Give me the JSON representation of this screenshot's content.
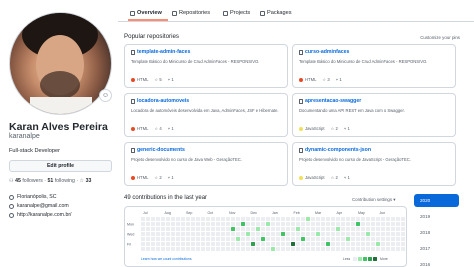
{
  "tabs": [
    {
      "label": "Overview",
      "active": true
    },
    {
      "label": "Repositories",
      "active": false
    },
    {
      "label": "Projects",
      "active": false
    },
    {
      "label": "Packages",
      "active": false
    }
  ],
  "profile": {
    "name": "Karan Alves Pereira",
    "login": "karanalpe",
    "bio": "Full-stack Developer",
    "edit_label": "Edit profile",
    "followers_count": "45",
    "followers_label": "followers",
    "following_count": "51",
    "following_label": "following",
    "stars_count": "33",
    "location": "Florianópolis, SC",
    "email": "karanalpe@gmail.com",
    "website": "http://karanalpe.com.br/"
  },
  "pinned": {
    "heading": "Popular repositories",
    "customize_label": "Customize your pins",
    "repos": [
      {
        "name": "template-admin-faces",
        "desc": "Template Básico do Minicurso de Crud AdminFaces - RESPONSIVO.",
        "lang": "HTML",
        "lang_color": "#e34c26",
        "stars": "5",
        "forks": "1"
      },
      {
        "name": "curso-adminfaces",
        "desc": "Template Básico do Minicurso de Crud AdminFaces - RESPONSIVO.",
        "lang": "HTML",
        "lang_color": "#e34c26",
        "stars": "3",
        "forks": "1"
      },
      {
        "name": "locadora-automoveis",
        "desc": "Locadora de automóveis desenvolvida em Java, AdminFaces, JSF e Hibernate.",
        "lang": "HTML",
        "lang_color": "#e34c26",
        "stars": "4",
        "forks": "1"
      },
      {
        "name": "apresentacao-swagger",
        "desc": "Documentando uma API REST em Java com o Swagger.",
        "lang": "JavaScript",
        "lang_color": "#f1e05a",
        "stars": "2",
        "forks": "1"
      },
      {
        "name": "generic-documents",
        "desc": "Projeto desenvolvido no curso de Java Web - GeraçãoTEC.",
        "lang": "HTML",
        "lang_color": "#e34c26",
        "stars": "2",
        "forks": "1"
      },
      {
        "name": "dynamic-components-json",
        "desc": "Projeto desenvolvido no curso de JavaScript - GeraçãoTEC.",
        "lang": "JavaScript",
        "lang_color": "#f1e05a",
        "stars": "2",
        "forks": "1"
      }
    ]
  },
  "contributions": {
    "heading": "49 contributions in the last year",
    "settings_label": "Contribution settings ▾",
    "months": [
      "Jul",
      "Aug",
      "Sep",
      "Oct",
      "Nov",
      "Dec",
      "Jan",
      "Feb",
      "Mar",
      "Apr",
      "May",
      "Jun"
    ],
    "days": [
      "Mon",
      "Wed",
      "Fri"
    ],
    "learn_label": "Learn how we count contributions",
    "less_label": "Less",
    "more_label": "More",
    "colors": [
      "#ebedf0",
      "#9be9a8",
      "#40c463",
      "#30a14e",
      "#216e39"
    ]
  },
  "years": [
    "2020",
    "2019",
    "2018",
    "2017",
    "2016"
  ]
}
